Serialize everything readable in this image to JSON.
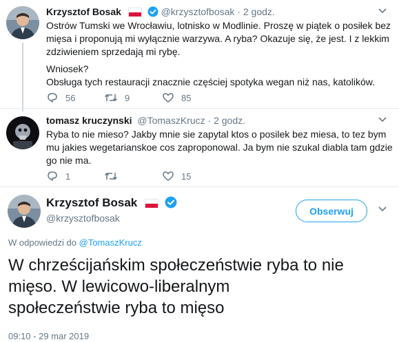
{
  "tweets": [
    {
      "name": "Krzysztof Bosak",
      "handle": "@krzysztofbosak",
      "time": "2 godz.",
      "lines": [
        "Ostrów Tumski we Wrocławiu, lotnisko w Modlinie. Proszę w piątek o posiłek bez",
        "mięsa i proponują mi wyłącznie warzywa. A ryba? Okazuje się, że jest. I z lekkim",
        "zdziwieniem sprzedają mi rybę.",
        "Wniosek?",
        "Obsługa tych restauracji znacznie częściej spotyka wegan niż nas, katolików."
      ],
      "counts": {
        "reply": "56",
        "retweet": "9",
        "like": "85"
      }
    },
    {
      "name": "tomasz kruczynski",
      "handle": "@TomaszKrucz",
      "time": "2 godz.",
      "lines": [
        "Ryba to nie mieso? Jakby mnie sie zapytal ktos o posilek bez miesa, to tez bym",
        "mu jakies wegetarianskoe cos zaproponowal. Ja bym nie szukal diabla tam gdzie",
        "go nie ma."
      ],
      "counts": {
        "reply": "1",
        "retweet": "",
        "like": "15"
      }
    }
  ],
  "main_tweet": {
    "name": "Krzysztof Bosak",
    "handle": "@krzysztofbosak",
    "follow_label": "Obserwuj",
    "reply_prefix": "W odpowiedzi do",
    "reply_to": "@TomaszKrucz",
    "lines": [
      "W chrześcijańskim społeczeństwie ryba to nie",
      "mięso. W lewicowo-liberalnym",
      "społeczeństwie ryba to mięso"
    ],
    "timestamp": "09:10 - 29 mar 2019"
  },
  "colors": {
    "accent": "#1da1f2",
    "muted": "#657786",
    "flag_red": "#dc143c"
  },
  "icons": [
    "reply-icon",
    "retweet-icon",
    "like-icon",
    "verified-icon",
    "chevron-down-icon",
    "flag-poland-icon"
  ]
}
